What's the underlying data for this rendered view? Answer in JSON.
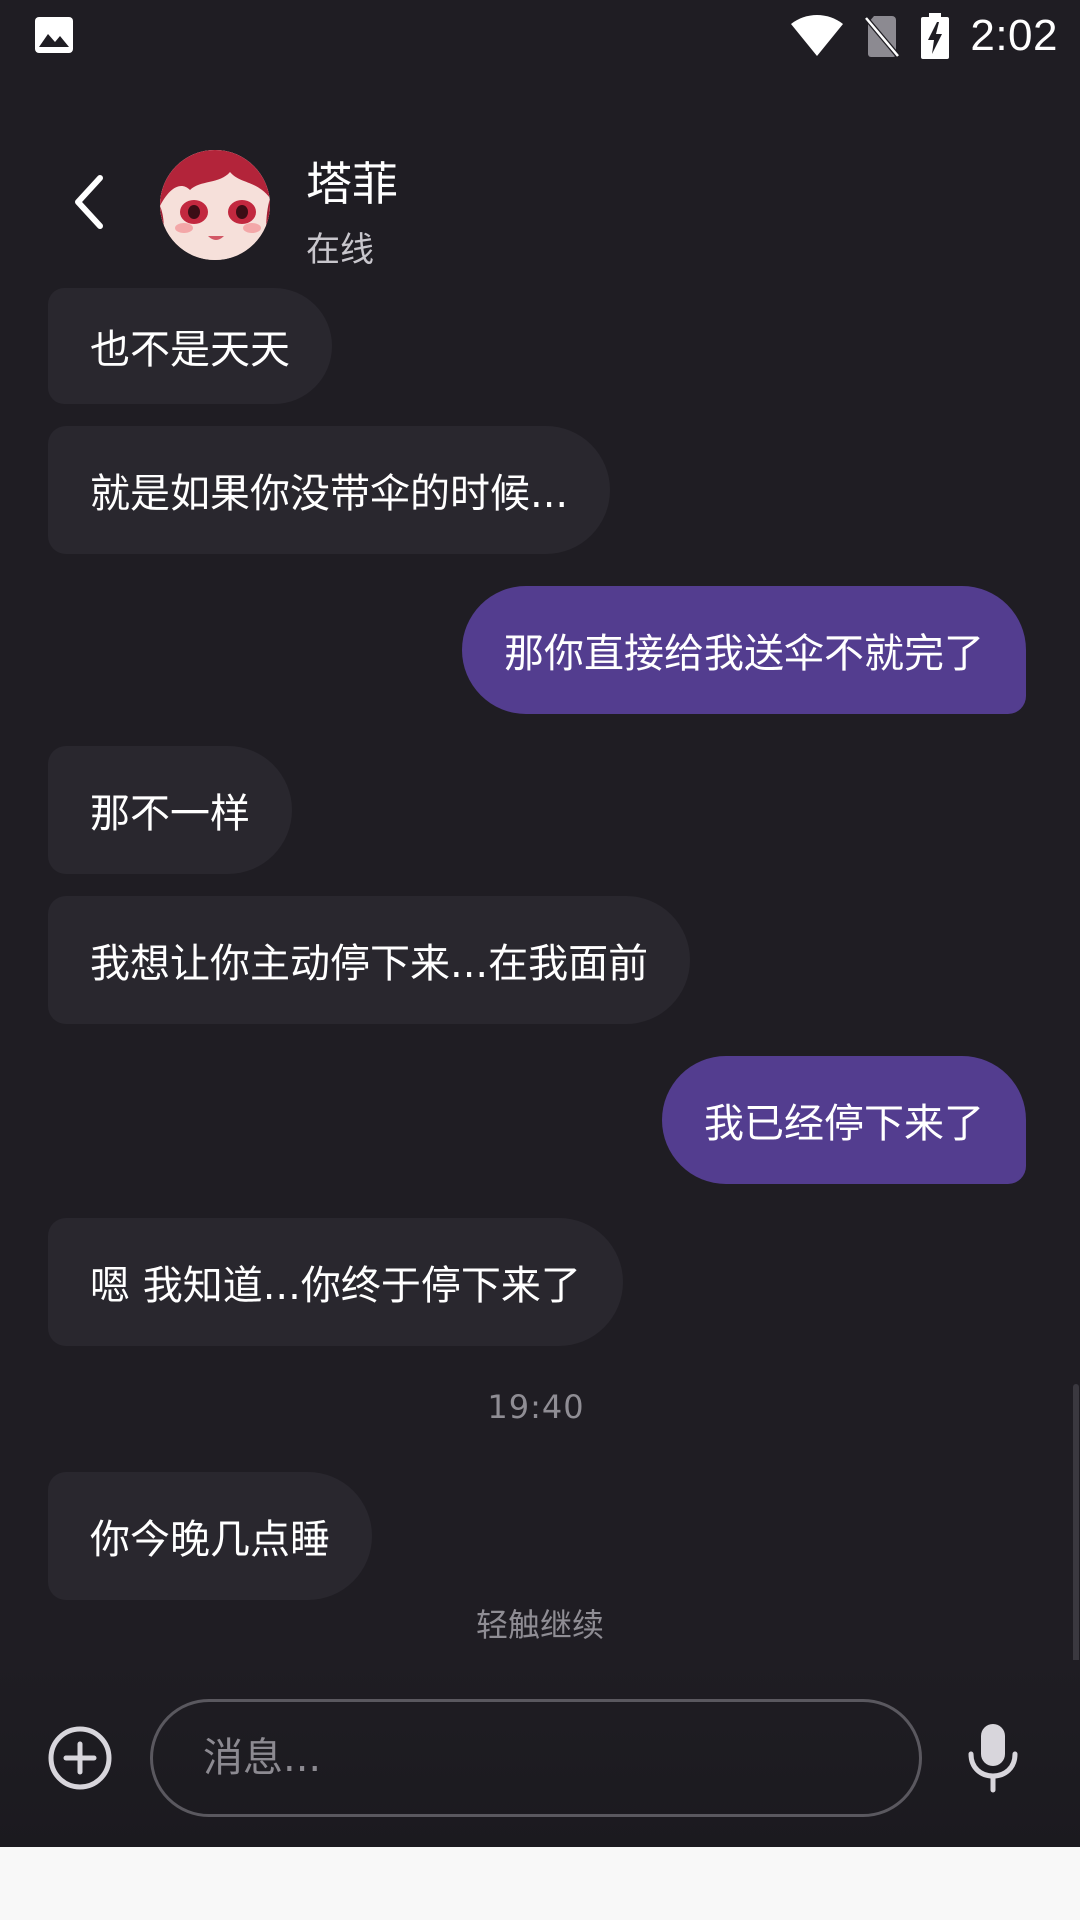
{
  "status_bar": {
    "time": "2:02",
    "icons": [
      "image-icon",
      "wifi-icon",
      "no-sim-icon",
      "battery-charging-icon"
    ]
  },
  "header": {
    "back_icon": "chevron-left-icon",
    "contact_name": "塔菲",
    "contact_status": "在线"
  },
  "messages": [
    {
      "side": "in",
      "text": "也不是天天"
    },
    {
      "side": "in",
      "text": "就是如果你没带伞的时候..."
    },
    {
      "side": "out",
      "text": "那你直接给我送伞不就完了"
    },
    {
      "side": "in",
      "text": "那不一样"
    },
    {
      "side": "in",
      "text": "我想让你主动停下来...在我面前"
    },
    {
      "side": "out",
      "text": "我已经停下来了"
    },
    {
      "side": "in",
      "text": "嗯 我知道...你终于停下来了"
    },
    {
      "side": "in",
      "text": "你今晚几点睡"
    }
  ],
  "timestamp": "19:40",
  "tap_to_continue": "轻触继续",
  "composer": {
    "add_icon": "plus-circle-icon",
    "placeholder": "消息...",
    "mic_icon": "microphone-icon"
  },
  "colors": {
    "background": "#1f1d23",
    "incoming_bubble": "#29272e",
    "outgoing_bubble": "#533d8f"
  }
}
